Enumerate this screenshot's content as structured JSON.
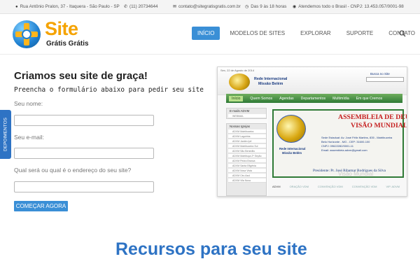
{
  "topbar": {
    "address": "Rua Antônio Pralon, 37 - Itaquera - São Paulo - SP",
    "phone": "(11) 20734644",
    "email": "contato@sitegratisgratis.com.br",
    "hours": "Das 9 às 18 horas",
    "coverage": "Atendemos todo o Brasil - CNPJ: 13.453.057/0001-98"
  },
  "logo": {
    "brand": "Site",
    "tagline": "Grátis Grátis"
  },
  "nav": {
    "items": [
      {
        "label": "INÍCIO",
        "active": true
      },
      {
        "label": "MODELOS DE SITES"
      },
      {
        "label": "EXPLORAR"
      },
      {
        "label": "SUPORTE"
      },
      {
        "label": "CONTATO"
      }
    ],
    "search_icon": "search-icon"
  },
  "main": {
    "title": "Criamos seu site de graça!",
    "subtitle": "Preencha o formulário abaixo para pedir seu site"
  },
  "form": {
    "name_label": "Seu nome:",
    "email_label": "Seu e-mail:",
    "site_label": "Qual será ou qual é o endereço do seu site?",
    "submit_label": "COMEÇAR AGORA"
  },
  "side_tab": {
    "label": "DEPOIMENTOS"
  },
  "preview": {
    "date": "Sex, 22 de Agosto de 2014",
    "header_line1": "Rede Internacional",
    "header_line2": "Missão Belém",
    "search_label": "Busca no Site",
    "menu": [
      "Início",
      "Quem Somos",
      "Agendas",
      "Departamentos",
      "Multimídia",
      "Em que Cremos"
    ],
    "sidebar_title1": "E-mails ADVM",
    "sidebar_item1": "WEBMAIL",
    "sidebar_title2": "Nossas Igrejas",
    "sidebar_items": [
      "ADVM Matribuceira",
      "ADVM Lagoinha",
      "ADVM Jardim Ipê",
      "ADVM Matribuceira Sul",
      "ADVM São Benedito",
      "ADVM Matribuça 2ª Seção",
      "ADVM Pedra Branca",
      "ADVM Santa Efigênia",
      "ADVM Nova Vista",
      "ADVM Céu Azul",
      "ADVM Vila Nova"
    ],
    "banner_title1": "ASSEMBLEIA DE DEUS",
    "banner_title2": "VISÃO MUNDIAL",
    "banner_rede": "Rede Internacional",
    "banner_missao": "Missão Belém",
    "banner_info": [
      "Sede Estadual: Av. José Félix Martins, 835 - Matribuceira",
      "Belo Horizonte - MG - CEP: 31600-100",
      "CNPJ: 09622282/0001-11",
      "Email: assembleia.advm@gmail.com"
    ],
    "banner_president": "Presidente: Pr. José Ribamar Rodrigues da Silva",
    "banner_watermark": "Visão Mundial",
    "tabs": [
      "ADVM",
      "ORAÇÃO VDM",
      "CONVENÇÃO VDM",
      "CONVENÇÃO VDM",
      "VIP. ADVM"
    ]
  },
  "section": {
    "title": "Recursos para seu site"
  },
  "colors": {
    "accent": "#3a8fd6",
    "brand_orange": "#f5a300",
    "nav_active": "#3a8fd6",
    "side_tab": "#2e73c4"
  }
}
